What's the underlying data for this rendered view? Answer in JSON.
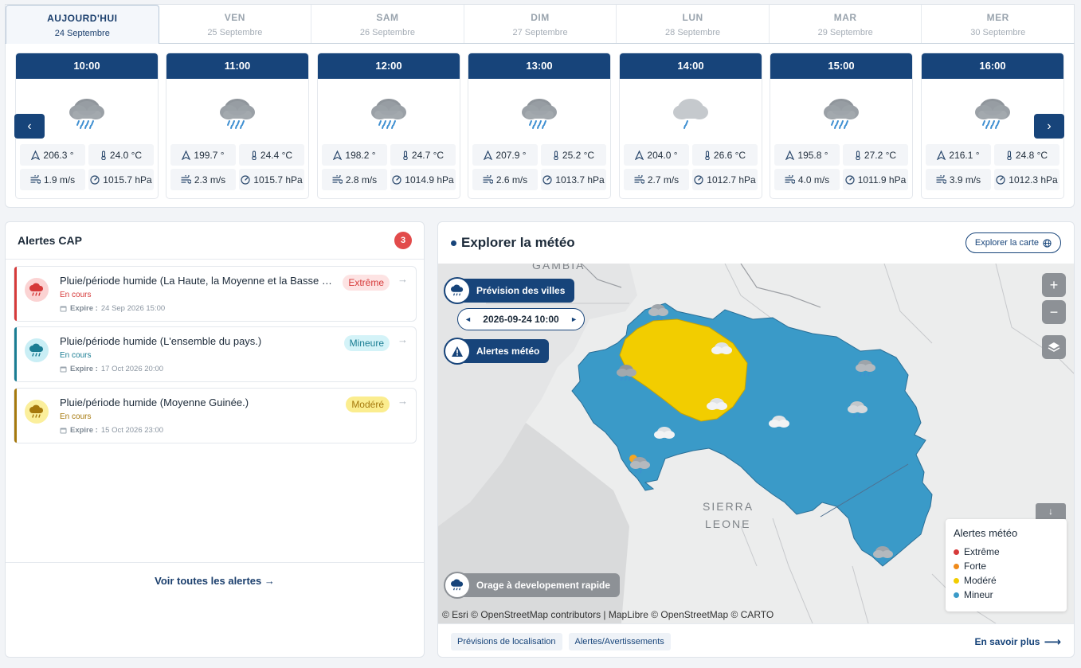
{
  "days": [
    {
      "name": "AUJOURD'HUI",
      "date": "24 Septembre"
    },
    {
      "name": "VEN",
      "date": "25 Septembre"
    },
    {
      "name": "SAM",
      "date": "26 Septembre"
    },
    {
      "name": "DIM",
      "date": "27 Septembre"
    },
    {
      "name": "LUN",
      "date": "28 Septembre"
    },
    {
      "name": "MAR",
      "date": "29 Septembre"
    },
    {
      "name": "MER",
      "date": "30 Septembre"
    }
  ],
  "hours": [
    {
      "time": "10:00",
      "dir": "206.3 °",
      "temp": "24.0 °C",
      "wind": "1.9 m/s",
      "pressure": "1015.7 hPa",
      "icon": "rain-cloud-icon"
    },
    {
      "time": "11:00",
      "dir": "199.7 °",
      "temp": "24.4 °C",
      "wind": "2.3 m/s",
      "pressure": "1015.7 hPa",
      "icon": "rain-cloud-icon"
    },
    {
      "time": "12:00",
      "dir": "198.2 °",
      "temp": "24.7 °C",
      "wind": "2.8 m/s",
      "pressure": "1014.9 hPa",
      "icon": "rain-cloud-icon"
    },
    {
      "time": "13:00",
      "dir": "207.9 °",
      "temp": "25.2 °C",
      "wind": "2.6 m/s",
      "pressure": "1013.7 hPa",
      "icon": "rain-cloud-icon"
    },
    {
      "time": "14:00",
      "dir": "204.0 °",
      "temp": "26.6 °C",
      "wind": "2.7 m/s",
      "pressure": "1012.7 hPa",
      "icon": "light-rain-cloud-icon"
    },
    {
      "time": "15:00",
      "dir": "195.8 °",
      "temp": "27.2 °C",
      "wind": "4.0 m/s",
      "pressure": "1011.9 hPa",
      "icon": "rain-cloud-icon"
    },
    {
      "time": "16:00",
      "dir": "216.1 °",
      "temp": "24.8 °C",
      "wind": "3.9 m/s",
      "pressure": "1012.3 hPa",
      "icon": "rain-cloud-icon"
    }
  ],
  "alerts": {
    "title": "Alertes CAP",
    "count": "3",
    "items": [
      {
        "title": "Pluie/période humide (La Haute, la Moyenne et la Basse Guinée.)",
        "status": "En cours",
        "expire_label": "Expire :",
        "expire": "24 Sep 2026 15:00",
        "level": "Extrême",
        "color": "#d63a3a",
        "bg": "#fde3e3",
        "icon_bg": "#fbd3d3"
      },
      {
        "title": "Pluie/période humide (L'ensemble du pays.)",
        "status": "En cours",
        "expire_label": "Expire :",
        "expire": "17 Oct 2026 20:00",
        "level": "Mineure",
        "color": "#1a7d93",
        "bg": "#d4f3f8",
        "icon_bg": "#c9eef5"
      },
      {
        "title": "Pluie/période humide (Moyenne Guinée.)",
        "status": "En cours",
        "expire_label": "Expire :",
        "expire": "15 Oct 2026 23:00",
        "level": "Modéré",
        "color": "#a6790d",
        "bg": "#fbed8f",
        "icon_bg": "#fbef9c"
      }
    ],
    "see_all": "Voir toutes les alertes →"
  },
  "map": {
    "title": "Explorer la météo",
    "explore_btn": "Explorer la carte",
    "city_forecast": "Prévision des villes",
    "date": "2026-09-24 10:00",
    "weather_alerts": "Alertes météo",
    "storm": "Orage à developement rapide",
    "label_gambia": "GAMBIA",
    "label_sierra": "SIERRA",
    "label_leone": "LEONE",
    "attribution": "© Esri © OpenStreetMap contributors | MapLibre © OpenStreetMap © CARTO",
    "legend": {
      "title": "Alertes météo",
      "items": [
        {
          "label": "Extrême",
          "color": "#d63a3a"
        },
        {
          "label": "Forte",
          "color": "#ef8a1a"
        },
        {
          "label": "Modéré",
          "color": "#f2cd00"
        },
        {
          "label": "Mineur",
          "color": "#3a9ac8"
        }
      ]
    },
    "footer_tags": [
      "Prévisions de localisation",
      "Alertes/Avertissements"
    ],
    "learn_more": "En savoir plus"
  },
  "colors": {
    "primary": "#17447a",
    "country": "#3a9ac8",
    "moderate_zone": "#f2cd00"
  }
}
